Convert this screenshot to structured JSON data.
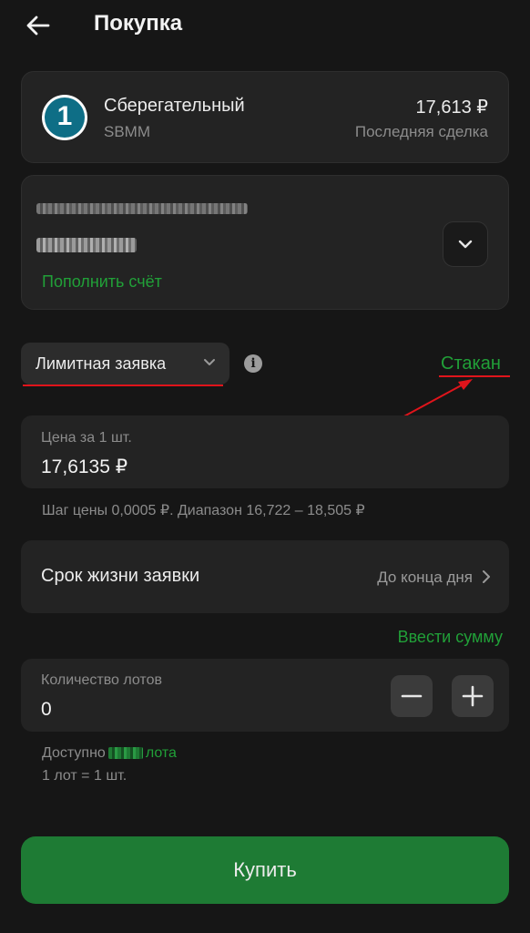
{
  "header": {
    "title": "Покупка"
  },
  "stock": {
    "name": "Сберегательный",
    "ticker": "SBMM",
    "logo_text": "1",
    "price": "17,613 ₽",
    "price_label": "Последняя сделка"
  },
  "account": {
    "topup_label": "Пополнить счёт"
  },
  "order": {
    "type_label": "Лимитная заявка",
    "orderbook_label": "Стакан"
  },
  "price_field": {
    "label": "Цена за 1 шт.",
    "value": "17,6135 ₽",
    "hint": "Шаг цены 0,0005 ₽. Диапазон 16,722 – 18,505 ₽"
  },
  "lifetime": {
    "label": "Срок жизни заявки",
    "value": "До конца дня"
  },
  "enter_sum_label": "Ввести сумму",
  "quantity": {
    "label": "Количество лотов",
    "value": "0"
  },
  "availability": {
    "prefix": "Доступно",
    "suffix": "лота",
    "lot_info": "1 лот = 1 шт."
  },
  "buy_label": "Купить",
  "colors": {
    "background": "#161616",
    "card": "#232323",
    "accent_green": "#21a038",
    "buy_button": "#1e7b34",
    "annotation_red": "#e0141b"
  }
}
